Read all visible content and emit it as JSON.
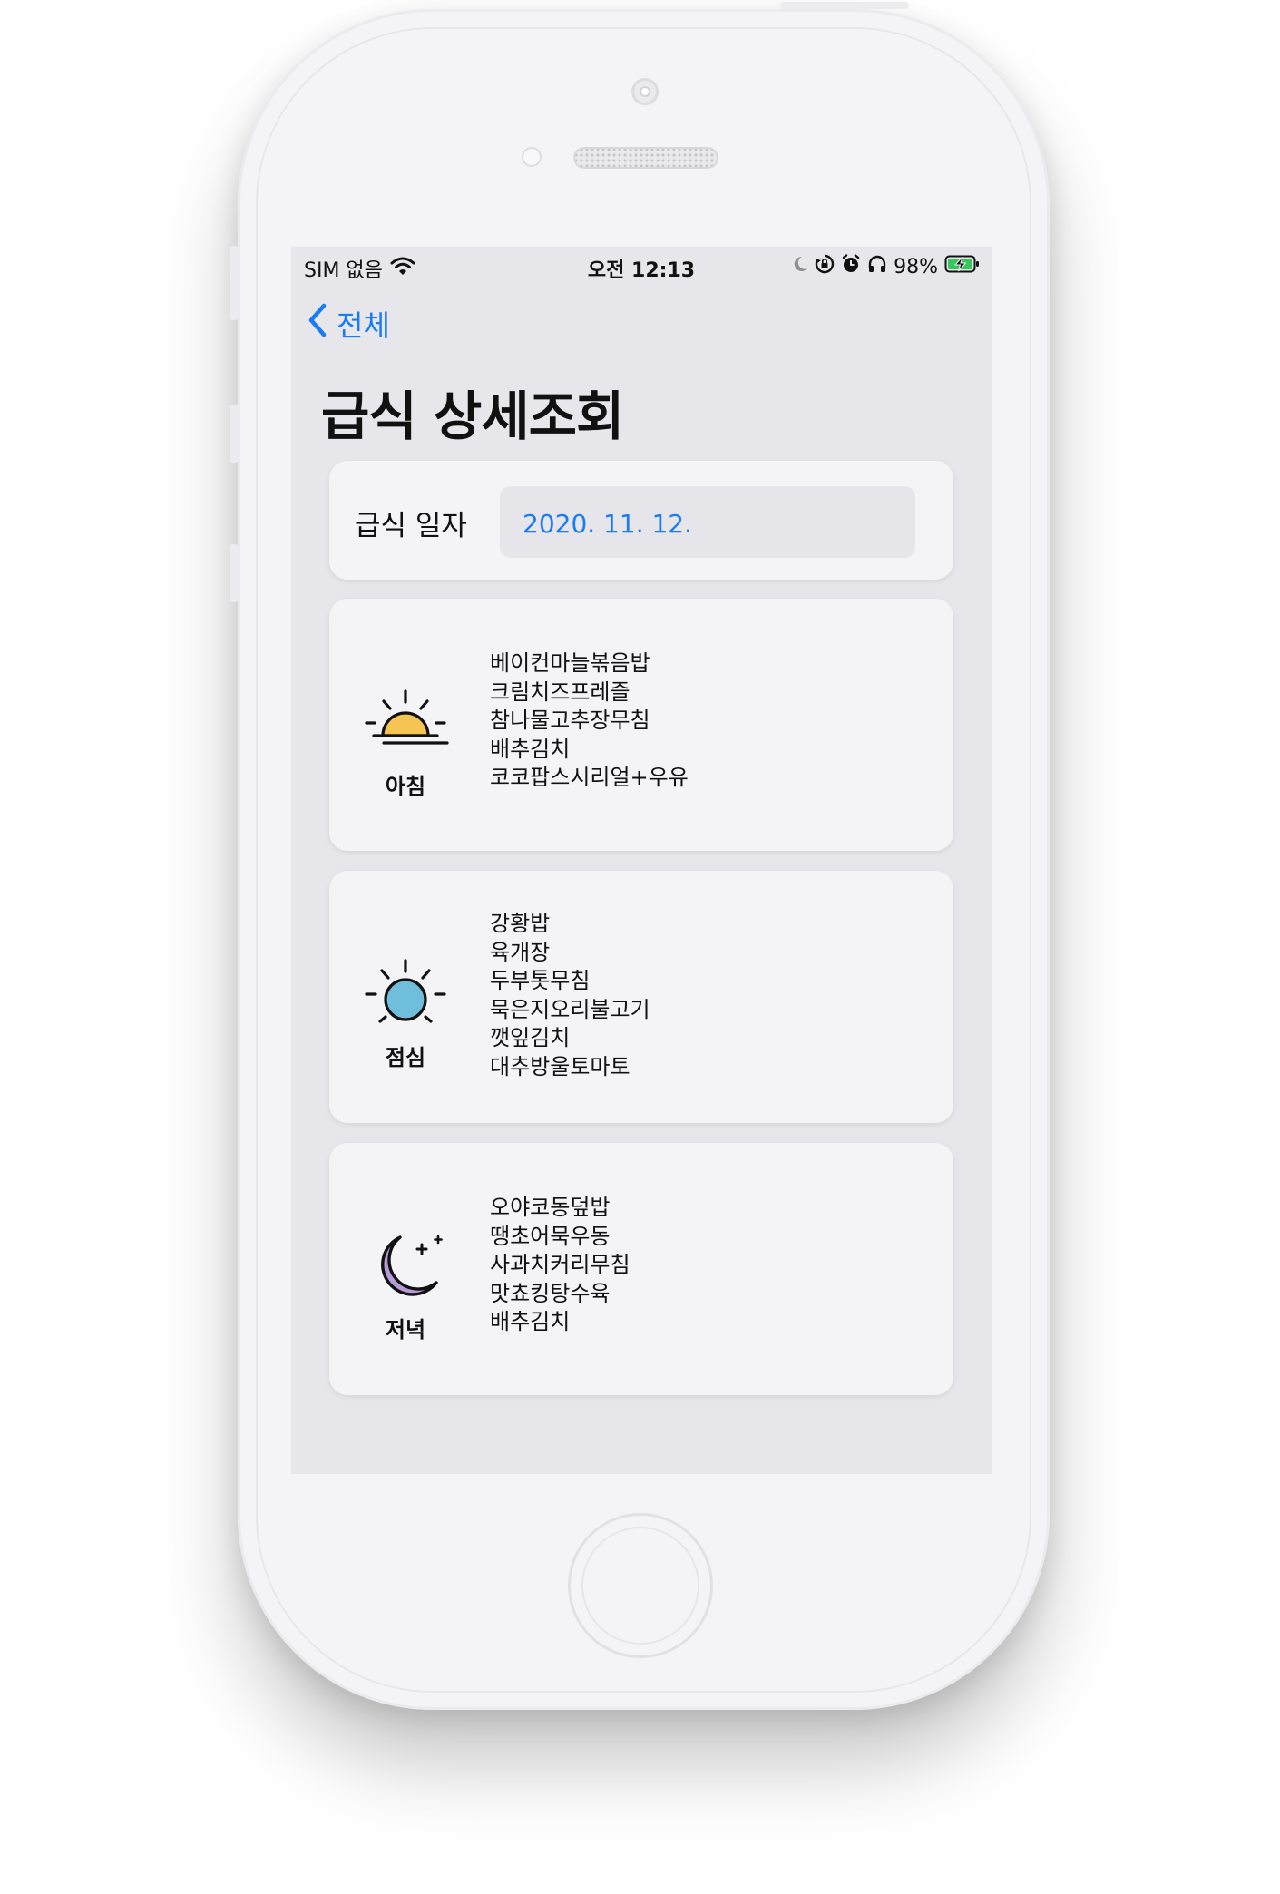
{
  "status_bar": {
    "carrier": "SIM 없음",
    "time": "오전 12:13",
    "battery": "98%",
    "battery_level": 0.98,
    "icons": [
      "wifi-icon",
      "moon-icon",
      "orientation-lock-icon",
      "alarm-icon",
      "headphones-icon",
      "battery-charging-icon"
    ]
  },
  "nav": {
    "back_label": "전체"
  },
  "page_title": "급식 상세조회",
  "date_row": {
    "label": "급식 일자",
    "value": "2020. 11. 12."
  },
  "colors": {
    "accent": "#1a7cf5",
    "sunrise": "#f6c452",
    "noon": "#6fbfdc",
    "moon": "#b79ad9"
  },
  "meals": [
    {
      "label": "아침",
      "icon": "sunrise-icon",
      "items": [
        "베이컨마늘볶음밥",
        "크림치즈프레즐",
        "참나물고추장무침",
        "배추김치",
        "코코팝스시리얼+우유"
      ]
    },
    {
      "label": "점심",
      "icon": "sun-icon",
      "items": [
        "강황밥",
        "육개장",
        "두부톳무침",
        "묵은지오리불고기",
        "깻잎김치",
        "대추방울토마토"
      ]
    },
    {
      "label": "저녁",
      "icon": "moon-icon",
      "items": [
        "오야코동덮밥",
        "땡초어묵우동",
        "사과치커리무침",
        "맛쵸킹탕수육",
        "배추김치"
      ]
    }
  ]
}
